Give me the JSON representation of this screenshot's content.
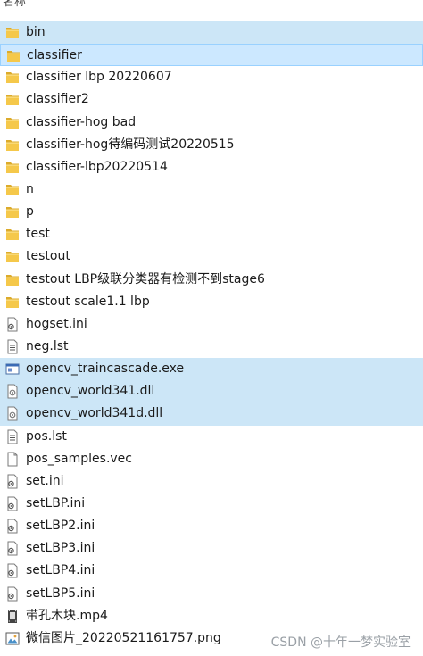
{
  "header": {
    "column_name": "名称"
  },
  "files": [
    {
      "name": "bin",
      "type": "folder",
      "state": "selected"
    },
    {
      "name": "classifier",
      "type": "folder",
      "state": "focused"
    },
    {
      "name": "classifier lbp 20220607",
      "type": "folder",
      "state": "none"
    },
    {
      "name": "classifier2",
      "type": "folder",
      "state": "none"
    },
    {
      "name": "classifier-hog  bad",
      "type": "folder",
      "state": "none"
    },
    {
      "name": "classifier-hog待编码测试20220515",
      "type": "folder",
      "state": "none"
    },
    {
      "name": "classifier-lbp20220514",
      "type": "folder",
      "state": "none"
    },
    {
      "name": "n",
      "type": "folder",
      "state": "none"
    },
    {
      "name": "p",
      "type": "folder",
      "state": "none"
    },
    {
      "name": "test",
      "type": "folder",
      "state": "none"
    },
    {
      "name": "testout",
      "type": "folder",
      "state": "none"
    },
    {
      "name": "testout LBP级联分类器有检测不到stage6",
      "type": "folder",
      "state": "none"
    },
    {
      "name": "testout scale1.1 lbp",
      "type": "folder",
      "state": "none"
    },
    {
      "name": "hogset.ini",
      "type": "ini",
      "state": "none"
    },
    {
      "name": "neg.lst",
      "type": "text",
      "state": "none"
    },
    {
      "name": "opencv_traincascade.exe",
      "type": "exe",
      "state": "selected"
    },
    {
      "name": "opencv_world341.dll",
      "type": "dll",
      "state": "selected"
    },
    {
      "name": "opencv_world341d.dll",
      "type": "dll",
      "state": "selected"
    },
    {
      "name": "pos.lst",
      "type": "text",
      "state": "none"
    },
    {
      "name": "pos_samples.vec",
      "type": "blank",
      "state": "none"
    },
    {
      "name": "set.ini",
      "type": "ini",
      "state": "none"
    },
    {
      "name": "setLBP.ini",
      "type": "ini",
      "state": "none"
    },
    {
      "name": "setLBP2.ini",
      "type": "ini",
      "state": "none"
    },
    {
      "name": "setLBP3.ini",
      "type": "ini",
      "state": "none"
    },
    {
      "name": "setLBP4.ini",
      "type": "ini",
      "state": "none"
    },
    {
      "name": "setLBP5.ini",
      "type": "ini",
      "state": "none"
    },
    {
      "name": "带孔木块.mp4",
      "type": "video",
      "state": "none"
    },
    {
      "name": "微信图片_20220521161757.png",
      "type": "image",
      "state": "none"
    }
  ],
  "watermark": "CSDN @十年一梦实验室",
  "colors": {
    "folder": "#f0c23e",
    "selection": "#cce8ff",
    "selection_border": "#99d1ff"
  }
}
